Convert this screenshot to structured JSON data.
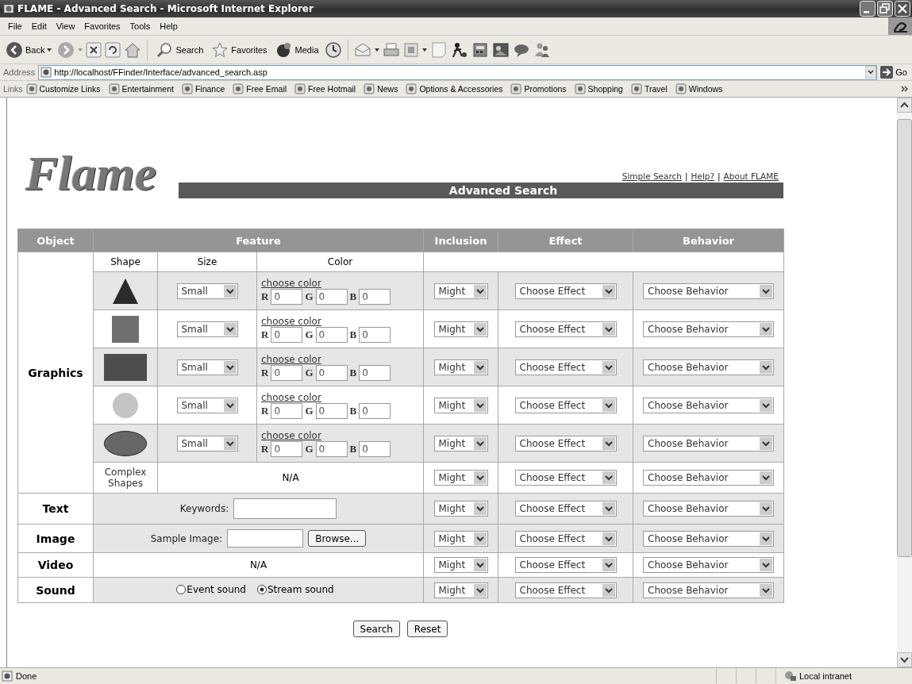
{
  "window": {
    "title": "FLAME - Advanced Search - Microsoft Internet Explorer"
  },
  "menu": [
    "File",
    "Edit",
    "View",
    "Favorites",
    "Tools",
    "Help"
  ],
  "toolbar": {
    "back": "Back",
    "search": "Search",
    "favorites": "Favorites",
    "media": "Media"
  },
  "address": {
    "label": "Address",
    "value": "http://localhost/FFinder/Interface/advanced_search.asp",
    "go": "Go"
  },
  "links": {
    "label": "Links",
    "items": [
      "Customize Links",
      "Entertainment",
      "Finance",
      "Free Email",
      "Free Hotmail",
      "News",
      "Options & Accessories",
      "Promotions",
      "Shopping",
      "Travel",
      "Windows"
    ]
  },
  "page": {
    "logo": "Flame",
    "nav_links": [
      "Simple Search",
      "Help?",
      "About FLAME"
    ],
    "nav_separator": "|",
    "banner": "Advanced Search"
  },
  "table": {
    "columns": [
      "Object",
      "Feature",
      "Inclusion",
      "Effect",
      "Behavior"
    ],
    "feature_columns": [
      "Shape",
      "Size",
      "Color"
    ],
    "graphics": {
      "label": "Graphics",
      "shapes": [
        {
          "kind": "triangle",
          "color": "#2b2b2b",
          "size": "Small",
          "color_link": "choose color",
          "channels": [
            {
              "label": "R",
              "value": "0"
            },
            {
              "label": "G",
              "value": "0"
            },
            {
              "label": "B",
              "value": "0"
            }
          ],
          "inclusion": "Might",
          "effect": "Choose Effect",
          "behavior": "Choose Behavior"
        },
        {
          "kind": "square",
          "color": "#707070",
          "size": "Small",
          "color_link": "choose color",
          "channels": [
            {
              "label": "R",
              "value": "0"
            },
            {
              "label": "G",
              "value": "0"
            },
            {
              "label": "B",
              "value": "0"
            }
          ],
          "inclusion": "Might",
          "effect": "Choose Effect",
          "behavior": "Choose Behavior"
        },
        {
          "kind": "rectangle",
          "color": "#4d4d4d",
          "size": "Small",
          "color_link": "choose color",
          "channels": [
            {
              "label": "R",
              "value": "0"
            },
            {
              "label": "G",
              "value": "0"
            },
            {
              "label": "B",
              "value": "0"
            }
          ],
          "inclusion": "Might",
          "effect": "Choose Effect",
          "behavior": "Choose Behavior"
        },
        {
          "kind": "circle",
          "color": "#c4c4c4",
          "size": "Small",
          "color_link": "choose color",
          "channels": [
            {
              "label": "R",
              "value": "0"
            },
            {
              "label": "G",
              "value": "0"
            },
            {
              "label": "B",
              "value": "0"
            }
          ],
          "inclusion": "Might",
          "effect": "Choose Effect",
          "behavior": "Choose Behavior"
        },
        {
          "kind": "ellipse",
          "color": "#666666",
          "size": "Small",
          "color_link": "choose color",
          "channels": [
            {
              "label": "R",
              "value": "0"
            },
            {
              "label": "G",
              "value": "0"
            },
            {
              "label": "B",
              "value": "0"
            }
          ],
          "inclusion": "Might",
          "effect": "Choose Effect",
          "behavior": "Choose Behavior"
        }
      ],
      "complex": {
        "label": "Complex Shapes",
        "feature": "N/A",
        "inclusion": "Might",
        "effect": "Choose Effect",
        "behavior": "Choose Behavior"
      }
    },
    "rows": [
      {
        "label": "Text",
        "kind": "keywords",
        "field_label": "Keywords:",
        "inclusion": "Might",
        "effect": "Choose Effect",
        "behavior": "Choose Behavior"
      },
      {
        "label": "Image",
        "kind": "file",
        "field_label": "Sample Image:",
        "button": "Browse...",
        "inclusion": "Might",
        "effect": "Choose Effect",
        "behavior": "Choose Behavior"
      },
      {
        "label": "Video",
        "kind": "none",
        "text": "N/A",
        "inclusion": "Might",
        "effect": "Choose Effect",
        "behavior": "Choose Behavior"
      },
      {
        "label": "Sound",
        "kind": "radios",
        "options": [
          {
            "label": "Event sound",
            "selected": false
          },
          {
            "label": "Stream sound",
            "selected": true
          }
        ],
        "inclusion": "Might",
        "effect": "Choose Effect",
        "behavior": "Choose Behavior"
      }
    ]
  },
  "buttons": [
    "Search",
    "Reset"
  ],
  "status_bar": {
    "text": "Done",
    "zone": "Local intranet"
  }
}
